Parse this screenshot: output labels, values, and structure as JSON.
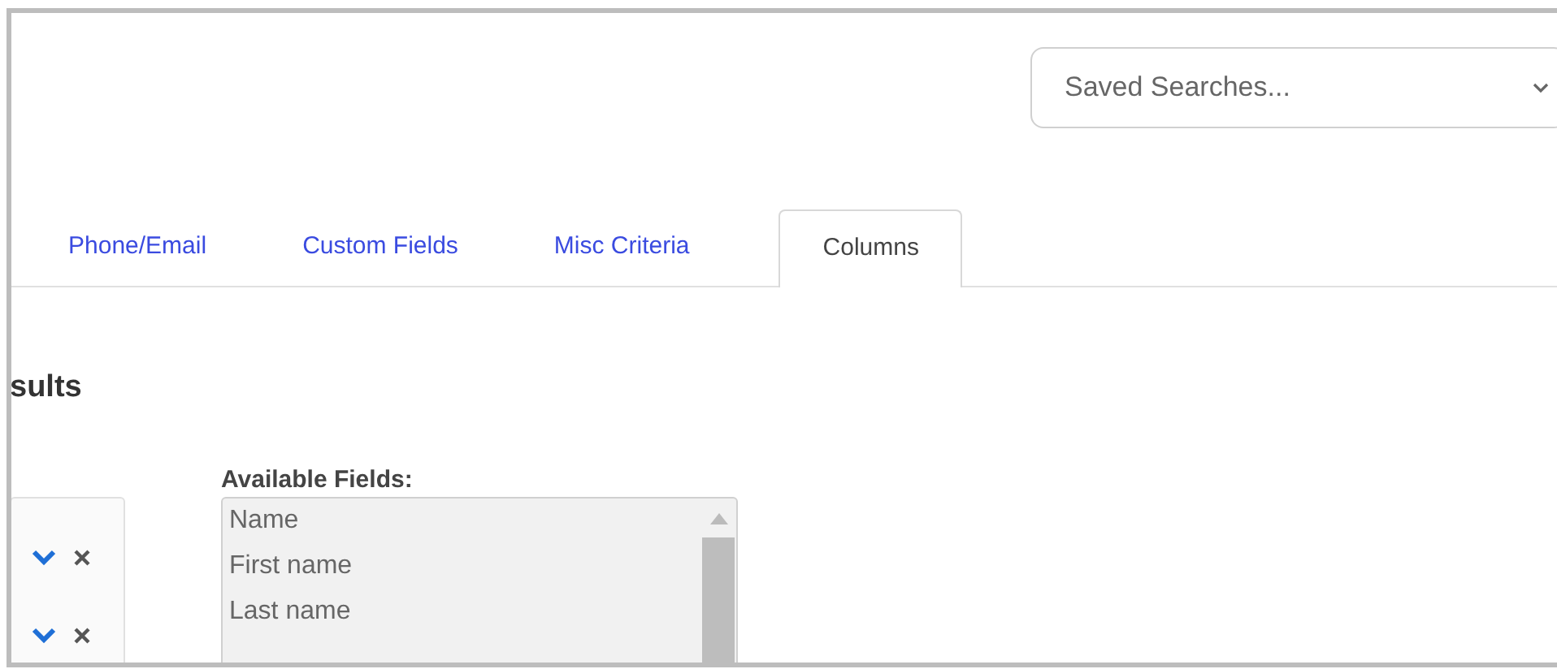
{
  "saved_searches": {
    "placeholder": "Saved Searches..."
  },
  "tabs": [
    {
      "label": "Phone/Email",
      "selected": false
    },
    {
      "label": "Custom Fields",
      "selected": false
    },
    {
      "label": "Misc Criteria",
      "selected": false
    },
    {
      "label": "Columns",
      "selected": true
    }
  ],
  "section_title": "sults",
  "available_fields": {
    "label": "Available Fields:",
    "items": [
      {
        "label": "Name"
      },
      {
        "label": "First name"
      },
      {
        "label": "Last name"
      }
    ]
  }
}
